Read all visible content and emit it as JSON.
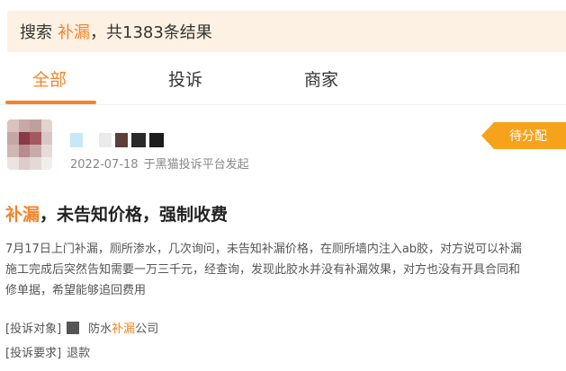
{
  "search_result": {
    "prefix": "搜索",
    "keyword": "补漏",
    "suffix": "，共1383条结果"
  },
  "tabs": [
    {
      "label": "全部",
      "active": true
    },
    {
      "label": "投诉",
      "active": false
    },
    {
      "label": "商家",
      "active": false
    }
  ],
  "complaint": {
    "date": "2022-07-18",
    "source": "于黑猫投诉平台发起",
    "status": "待分配",
    "title_keyword": "补漏",
    "title_rest": "，未告知价格，强制收费",
    "description_lines": [
      "7月17日上门补漏，厕所渗水，几次询问，未告知补漏价格，在厕所墙内注入ab胶，对方说可以补漏",
      "施工完成后突然告知需要一万三千元，经查询，发现此胶水并没有补漏效果，对方也没有开具合同和",
      "修单据，希望能够追回费用"
    ],
    "target_label": "[投诉对象]",
    "target_prefix": "防水",
    "target_keyword": "补漏",
    "target_suffix": "公司",
    "demand_label": "[投诉要求]",
    "demand_value": "退款"
  },
  "colors": {
    "accent": "#f3842a",
    "badge": "#f7a21b",
    "result_bar_bg": "#fdf1e3"
  }
}
